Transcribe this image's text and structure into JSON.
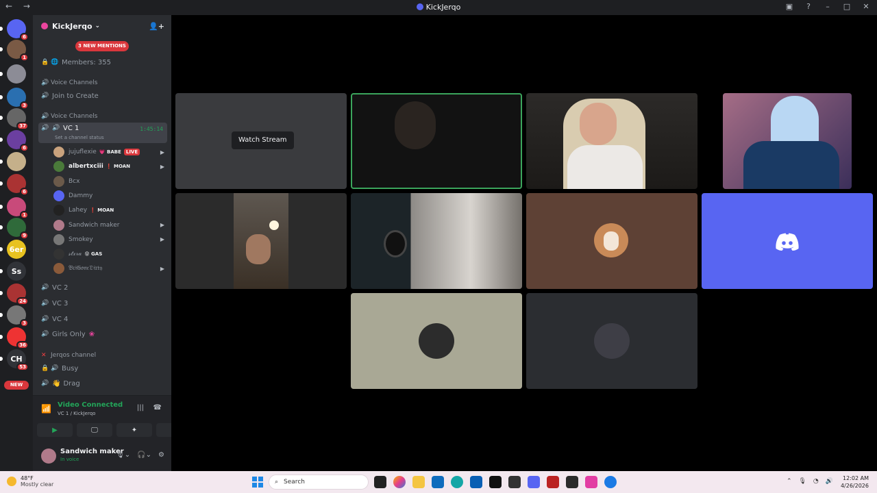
{
  "window": {
    "title": "KickJerqo",
    "nav": "←  →",
    "controls": [
      "▣",
      "?",
      "–",
      "□",
      "✕"
    ]
  },
  "server_rail": {
    "items": [
      {
        "name": "discord-home",
        "badge": "6",
        "label": ""
      },
      {
        "name": "server-1",
        "badge": "1",
        "label": ""
      },
      {
        "name": "server-2",
        "badge": "",
        "label": ""
      },
      {
        "name": "server-3",
        "badge": "3",
        "label": ""
      },
      {
        "name": "server-4",
        "badge": "37",
        "label": ""
      },
      {
        "name": "server-5",
        "badge": "6",
        "label": ""
      },
      {
        "name": "server-6",
        "badge": "",
        "label": ""
      },
      {
        "name": "server-7",
        "badge": "6",
        "label": ""
      },
      {
        "name": "server-8",
        "badge": "1",
        "label": ""
      },
      {
        "name": "server-9",
        "badge": "9",
        "label": ""
      },
      {
        "name": "server-10",
        "badge": "",
        "label": "6er"
      },
      {
        "name": "server-11",
        "badge": "",
        "label": "Ss"
      },
      {
        "name": "server-12",
        "badge": "24",
        "label": ""
      },
      {
        "name": "server-13",
        "badge": "3",
        "label": ""
      },
      {
        "name": "server-14",
        "badge": "36",
        "label": ""
      },
      {
        "name": "server-15",
        "badge": "53",
        "label": "CH"
      }
    ],
    "new_label": "NEW"
  },
  "guild": {
    "name": "KickJerqo",
    "mentions": "3 NEW MENTIONS"
  },
  "channels": {
    "members": "Members: 355",
    "cat1": "Voice Channels",
    "join_create": "Join to Create",
    "cat2": "Voice Channels",
    "vc1": {
      "name": "VC 1",
      "time": "1:45:14",
      "status": "Set a channel status"
    },
    "users": [
      {
        "name": "jujuflexie",
        "tag": "💗 BABE",
        "live": "LIVE"
      },
      {
        "name": "albertxciii",
        "tag": "❗ MOAN",
        "live": ""
      },
      {
        "name": "Bcx",
        "tag": "",
        "live": ""
      },
      {
        "name": "Dammy",
        "tag": "",
        "live": ""
      },
      {
        "name": "Lahey",
        "tag": "❗ MOAN",
        "live": ""
      },
      {
        "name": "Sandwich maker",
        "tag": "",
        "live": ""
      },
      {
        "name": "Smokey",
        "tag": "",
        "live": ""
      },
      {
        "name": "𝓈𝓉𝓍𝓇𝒶",
        "tag": "😵 GAS",
        "live": ""
      },
      {
        "name": "𝔅𝔯𝔦𝔊𝔬𝔫𝔢𝔇𝔦𝔯𝔱𝔶",
        "tag": "",
        "live": ""
      }
    ],
    "vc2": "VC 2",
    "vc3": "VC 3",
    "vc4": "VC 4",
    "girls": "Girls Only",
    "cat3": "Jerqos channel",
    "busy": "Busy",
    "drag": "Drag"
  },
  "voice_panel": {
    "status": "Video Connected",
    "sub": "VC 1 / KickJerqo"
  },
  "user_panel": {
    "name": "Sandwich maker",
    "sub": "In voice"
  },
  "stage": {
    "watch_label": "Watch Stream"
  },
  "taskbar": {
    "temp": "48°F",
    "weather": "Mostly clear",
    "search": "Search",
    "time": "12:02 AM",
    "date": "4/26/2026"
  }
}
